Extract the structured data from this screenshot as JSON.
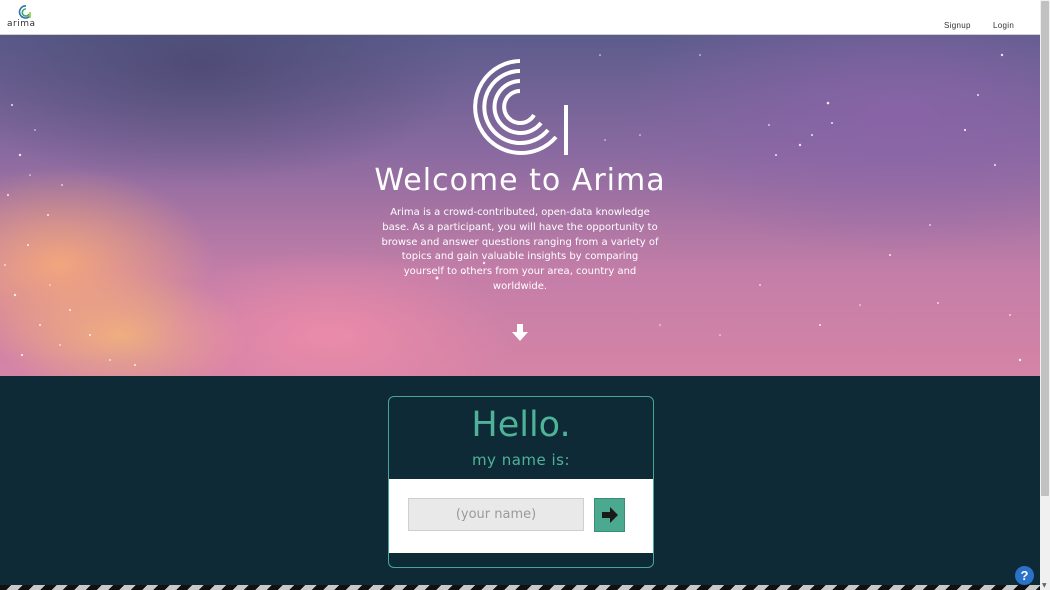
{
  "brand": {
    "name": "arima",
    "logo_icon": "arima-logo-icon"
  },
  "nav": {
    "signup_label": "Signup",
    "login_label": "Login"
  },
  "hero": {
    "title": "Welcome to Arima",
    "description": "Arima is a crowd-contributed, open-data knowledge base. As a participant, you will have the opportunity to browse and answer questions ranging from a variety of topics and gain valuable insights by comparing yourself to others from your area, country and worldwide.",
    "scroll_icon": "arrow-down-icon"
  },
  "card": {
    "greeting": "Hello.",
    "subtitle": "my name is:",
    "name_input": {
      "value": "",
      "placeholder": "(your name)"
    },
    "submit_icon": "arrow-right-icon"
  },
  "help": {
    "label": "?",
    "icon": "help-icon"
  },
  "colors": {
    "accent": "#4fb39a",
    "dark_bg": "#0e2a36",
    "help_blue": "#2a72c9"
  }
}
